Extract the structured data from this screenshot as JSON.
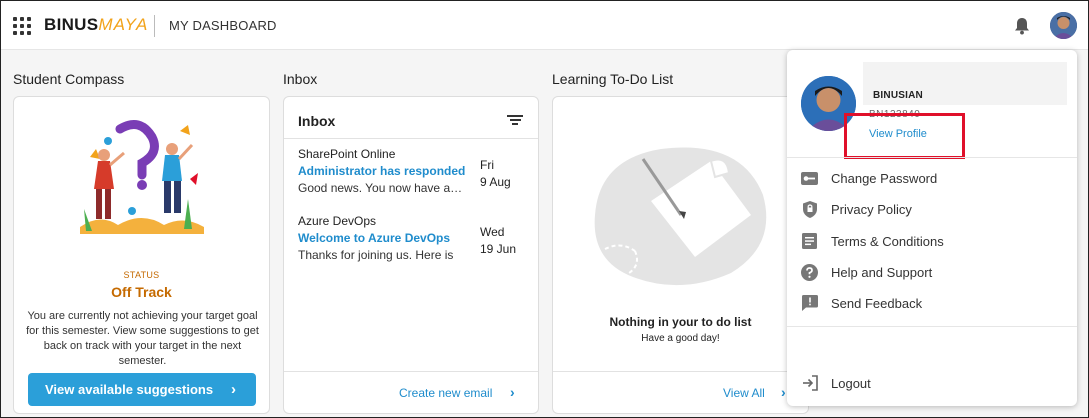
{
  "header": {
    "logo_primary": "BINUS",
    "logo_secondary": "MAYA",
    "title": "MY DASHBOARD"
  },
  "sections": {
    "compass_title": "Student Compass",
    "inbox_title": "Inbox",
    "todo_title": "Learning To-Do List"
  },
  "compass": {
    "status_label": "STATUS",
    "status_value": "Off Track",
    "description": "You are currently not achieving your target goal for this semester. View some suggestions to get back on track with your target in the next semester.",
    "button_label": "View available suggestions"
  },
  "inbox": {
    "header": "Inbox",
    "messages": [
      {
        "sender": "SharePoint Online",
        "subject": "Administrator has responded",
        "preview": "Good news. You now have access",
        "day": "Fri",
        "date": "9 Aug"
      },
      {
        "sender": "Azure DevOps",
        "subject": "Welcome to Azure DevOps",
        "preview": "Thanks for joining us. Here is",
        "day": "Wed",
        "date": "19 Jun"
      }
    ],
    "footer_link": "Create new email"
  },
  "todo": {
    "empty_title": "Nothing in your to do list",
    "empty_subtitle": "Have a good day!",
    "footer_link": "View All"
  },
  "profile": {
    "role": "BINUSIAN",
    "id": "BN123840",
    "view_profile": "View Profile",
    "menu": [
      {
        "label": "Change Password",
        "icon": "key-icon"
      },
      {
        "label": "Privacy Policy",
        "icon": "shield-icon"
      },
      {
        "label": "Terms & Conditions",
        "icon": "document-icon"
      },
      {
        "label": "Help and Support",
        "icon": "help-icon"
      },
      {
        "label": "Send Feedback",
        "icon": "feedback-icon"
      }
    ],
    "logout": "Logout"
  },
  "colors": {
    "accent": "#2b9fd9",
    "link": "#1f8ccc",
    "status": "#c56a00",
    "brand_secondary": "#f2a31b",
    "highlight": "#e0102a"
  }
}
